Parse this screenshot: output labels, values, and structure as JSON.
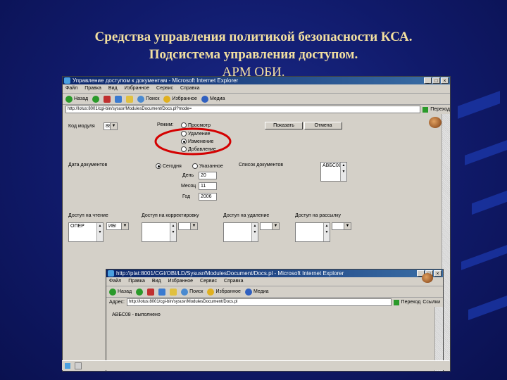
{
  "slide": {
    "title_line1": "Средства управления политикой безопасности КСА.",
    "title_line2": "Подсистема управления доступом.",
    "title_line3": "АРМ ОБИ."
  },
  "main_window": {
    "title": "Управление доступом к документам - Microsoft Internet Explorer",
    "menu": [
      "Файл",
      "Правка",
      "Вид",
      "Избранное",
      "Сервис",
      "Справка"
    ],
    "toolbar": {
      "back": "Назад",
      "search": "Поиск",
      "favorites": "Избранное",
      "media": "Медиа"
    },
    "address": "http://lotus:8001/cgi-bin/sysusr/ModulesDocument/Docs.pl?mode=",
    "go_label": "Переход",
    "form": {
      "module_label": "Код модуля",
      "module_value": "88",
      "mode_label": "Режим:",
      "mode_options": [
        "Просмотр",
        "Удаление",
        "Изменение",
        "Добавление"
      ],
      "btn_show": "Показать",
      "btn_cancel": "Отмена",
      "date_label": "Дата документов",
      "date_today": "Сегодня",
      "date_custom": "Указанное",
      "day_label": "День",
      "day_value": "20",
      "month_label": "Месяц",
      "month_value": "11",
      "year_label": "Год",
      "year_value": "2006",
      "doclist_label": "Список документов",
      "doclist_value": "АВБС08",
      "access_read": "Доступ на чтение",
      "access_read_value": "ОПЕР",
      "access_read_dd": "ИБ!",
      "access_edit": "Доступ на корректировку",
      "access_delete": "Доступ на удаление",
      "access_send": "Доступ на рассылку"
    }
  },
  "popup_window": {
    "title": "http://plat:8001/CGI/OBI/LD/Sysusr/ModulesDocument/Docs.pl - Microsoft Internet Explorer",
    "menu": [
      "Файл",
      "Правка",
      "Вид",
      "Избранное",
      "Сервис",
      "Справка"
    ],
    "toolbar": {
      "back": "Назад",
      "search": "Поиск",
      "favorites": "Избранное",
      "media": "Медиа"
    },
    "address_label": "Адрес:",
    "address": "http://lotus:8001/cgi-bin/sysusr/ModulesDocument/Docs.pl",
    "go_label": "Переход",
    "links_label": "Ссылки",
    "message": "АВБС08 - выполнено"
  },
  "colors": {
    "accent": "#d40000",
    "title": "#f2dfa0",
    "background": "#101a6a"
  }
}
